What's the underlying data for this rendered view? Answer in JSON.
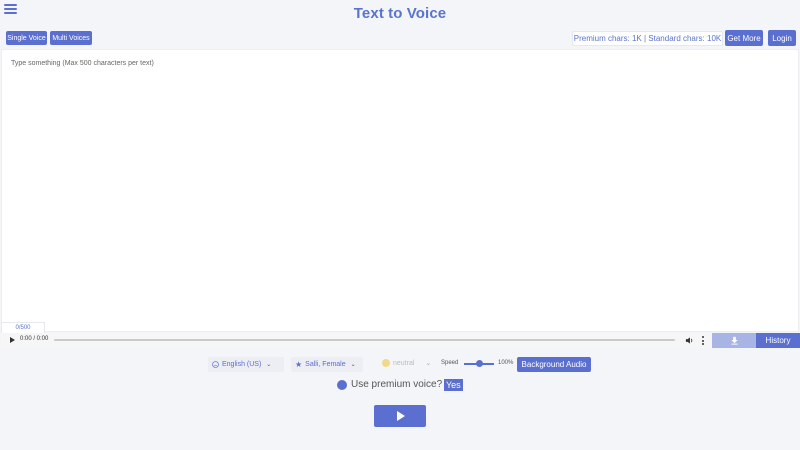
{
  "header": {
    "title": "Text to Voice",
    "menu_icon": "hamburger-menu-icon"
  },
  "modes": {
    "single_label": "Single Voice",
    "multi_label": "Multi Voices"
  },
  "account": {
    "chars_info": "Premium chars: 1K | Standard chars: 10K",
    "get_more_label": "Get More",
    "login_label": "Login"
  },
  "editor": {
    "placeholder": "Type something (Max 500 characters per text)",
    "counter": "0/500"
  },
  "player": {
    "time": "0:00 / 0:00",
    "history_label": "History",
    "download_icon": "download-icon"
  },
  "controls": {
    "language": "English (US)",
    "voice": "Salli, Female",
    "style": "neutral",
    "speed_label": "Speed",
    "speed_value": "100%",
    "speed_fraction": 0.5,
    "background_audio_label": "Background Audio"
  },
  "premium": {
    "question": "Use premium voice?",
    "answer": "Yes"
  },
  "colors": {
    "accent": "#5a6fd0",
    "title": "#5a74cc",
    "background": "#f4f5f8"
  }
}
